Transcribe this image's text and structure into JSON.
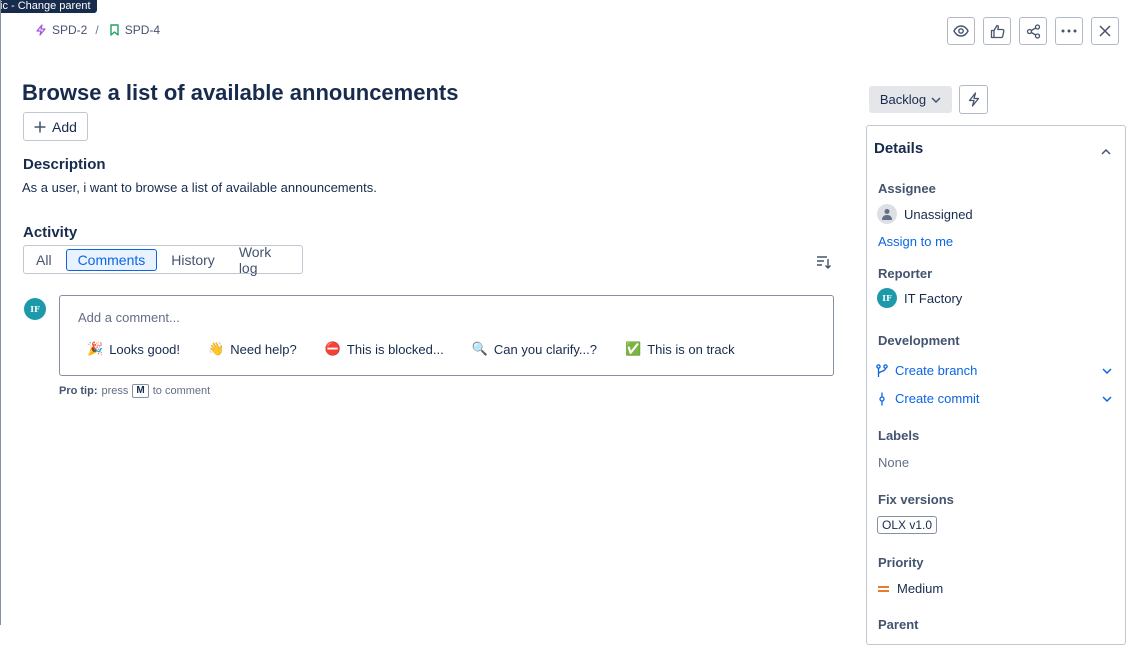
{
  "tooltip": "ic - Change parent",
  "breadcrumb": {
    "parent": "SPD-2",
    "separator": "/",
    "current": "SPD-4"
  },
  "issue": {
    "title": "Browse a list of available announcements",
    "add_label": "Add",
    "description_heading": "Description",
    "description": "As a user, i want to browse a list of available announcements."
  },
  "activity": {
    "heading": "Activity",
    "tabs": [
      "All",
      "Comments",
      "History",
      "Work log"
    ],
    "active_tab": "Comments"
  },
  "comment": {
    "avatar_initials": "IF",
    "placeholder": "Add a comment...",
    "quick_replies": [
      {
        "emoji": "🎉",
        "label": "Looks good!"
      },
      {
        "emoji": "👋",
        "label": "Need help?"
      },
      {
        "emoji": "⛔",
        "label": "This is blocked..."
      },
      {
        "emoji": "🔍",
        "label": "Can you clarify...?"
      },
      {
        "emoji": "✅",
        "label": "This is on track"
      }
    ],
    "pro_tip_label": "Pro tip:",
    "pro_tip_press": "press",
    "pro_tip_key": "M",
    "pro_tip_suffix": "to comment"
  },
  "status": {
    "label": "Backlog"
  },
  "details": {
    "heading": "Details",
    "assignee_label": "Assignee",
    "assignee_value": "Unassigned",
    "assign_to_me": "Assign to me",
    "reporter_label": "Reporter",
    "reporter_initials": "IF",
    "reporter_value": "IT Factory",
    "development_label": "Development",
    "create_branch": "Create branch",
    "create_commit": "Create commit",
    "labels_label": "Labels",
    "labels_value": "None",
    "fix_versions_label": "Fix versions",
    "fix_version": "OLX v1.0",
    "priority_label": "Priority",
    "priority_value": "Medium",
    "parent_label": "Parent"
  },
  "colors": {
    "link": "#0c66e4",
    "avatar": "#1d9aaa",
    "priority_medium": "#e56910",
    "epic": "#9f55d8",
    "story": "#22a06b"
  }
}
